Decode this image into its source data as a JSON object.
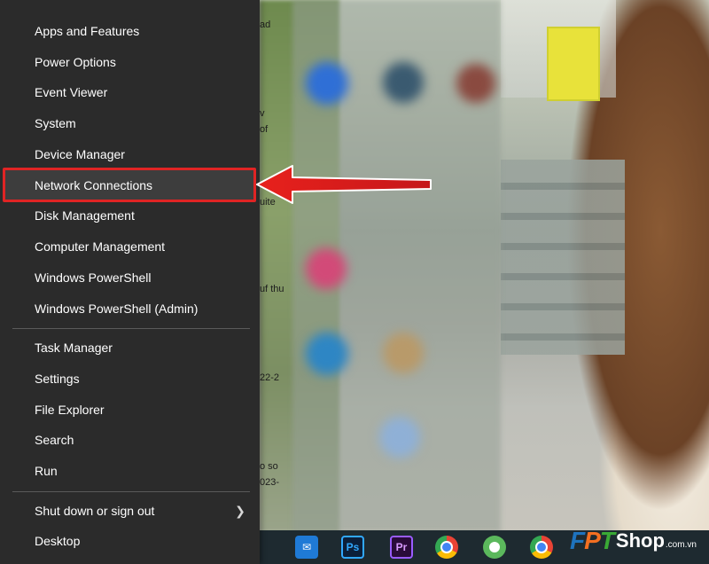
{
  "menu": {
    "items": [
      {
        "label": "Apps and Features"
      },
      {
        "label": "Power Options"
      },
      {
        "label": "Event Viewer"
      },
      {
        "label": "System"
      },
      {
        "label": "Device Manager"
      },
      {
        "label": "Network Connections"
      },
      {
        "label": "Disk Management"
      },
      {
        "label": "Computer Management"
      },
      {
        "label": "Windows PowerShell"
      },
      {
        "label": "Windows PowerShell (Admin)"
      },
      {
        "label": "Task Manager"
      },
      {
        "label": "Settings"
      },
      {
        "label": "File Explorer"
      },
      {
        "label": "Search"
      },
      {
        "label": "Run"
      },
      {
        "label": "Shut down or sign out"
      },
      {
        "label": "Desktop"
      }
    ],
    "highlighted": "Network Connections",
    "highlight_color": "#e02424"
  },
  "desktop_fragments": [
    "ad",
    "v",
    "so",
    "of",
    "uite",
    "uf thu",
    "22-2",
    "o so",
    "023-"
  ],
  "taskbar": {
    "icons": [
      {
        "name": "mail-icon",
        "glyph": "✉"
      },
      {
        "name": "photoshop-icon",
        "glyph": "Ps"
      },
      {
        "name": "premiere-icon",
        "glyph": "Pr"
      },
      {
        "name": "chrome-icon",
        "glyph": ""
      },
      {
        "name": "coccoc-icon",
        "glyph": ""
      },
      {
        "name": "chrome-alt-icon",
        "glyph": ""
      }
    ]
  },
  "brand": {
    "fpt": "FPT",
    "shop": "Shop",
    "domain": ".com.vn"
  }
}
